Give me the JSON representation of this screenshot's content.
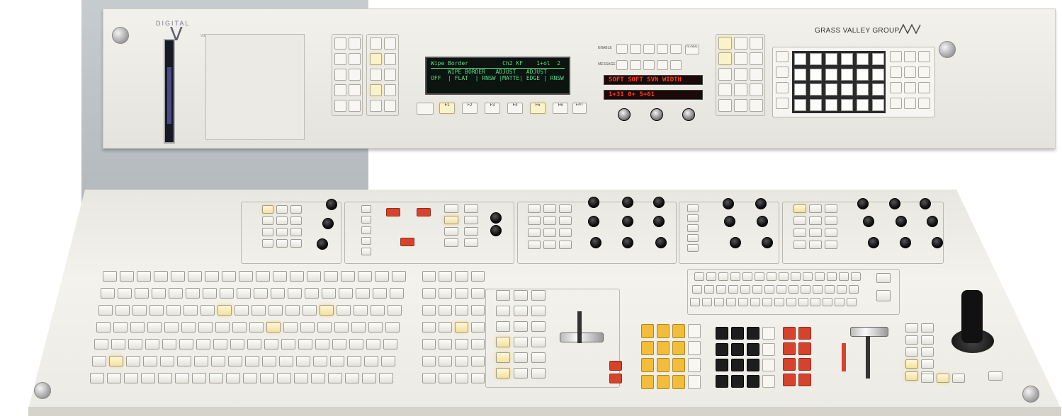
{
  "rack": {
    "logo": {
      "wordmark": "DIGITAL",
      "mark": "V",
      "sub": "VIDEO"
    },
    "brand": "GRASS VALLEY GROUP",
    "brand_mark": "GVG",
    "lcd": {
      "line1": "Wipe Border          Ch2 KF    1+ol  2",
      "line2": "     WIPE BORDER   ADJUST   ADJUST",
      "line3": "OFF  | FLAT  | RNSW |MATTE| EDGE | RNSW"
    },
    "led_top": "SOFT  SOFT  SVN  WIDTH",
    "led_bottom": "1+31     0+     5+61",
    "labels": {
      "enable": "ENABLE",
      "message": "MESSAGE",
      "global": "GLOBAL"
    },
    "soft_keys": [
      "F1",
      "F2",
      "F3",
      "F4",
      "F5",
      "F6"
    ],
    "exit_key": "EXIT"
  },
  "colors": {
    "lcd_text": "#5fd98a",
    "led": "#ff3b22",
    "lit_key": "#fbf3c8",
    "red_key": "#d6432c",
    "yellow_key": "#f2bd3a"
  },
  "icons": [
    "screw-icon",
    "knob-icon",
    "joystick-icon",
    "tbar-icon",
    "wipe-pattern-icon"
  ]
}
